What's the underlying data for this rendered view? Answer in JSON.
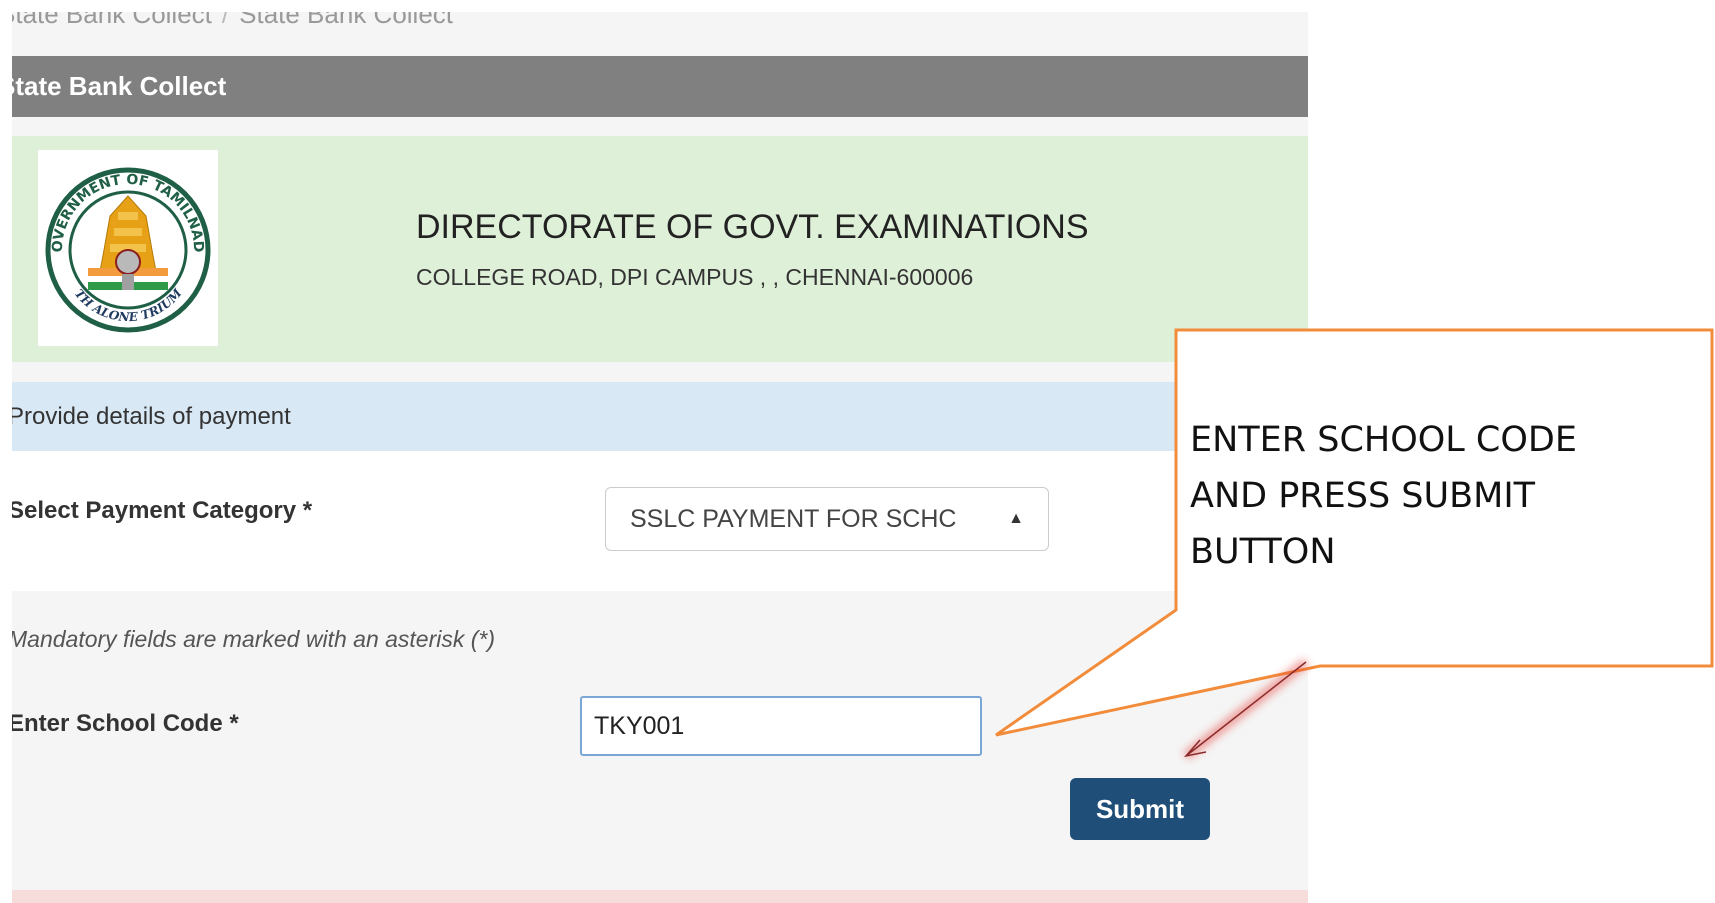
{
  "breadcrumb": [
    "State Bank Collect",
    "State Bank Collect"
  ],
  "breadcrumb_separator": "/",
  "header": {
    "title": "State Bank Collect"
  },
  "merchant": {
    "name": "DIRECTORATE OF GOVT. EXAMINATIONS",
    "address": "COLLEGE ROAD, DPI CAMPUS , , CHENNAI-600006",
    "emblem_text_top": "GOVERNMENT OF TAMILNADU",
    "emblem_text_bottom": "TRUTH ALONE TRIUMPHS"
  },
  "form": {
    "heading": "Provide details of payment",
    "category_label": "Select Payment Category *",
    "category_value": "SSLC PAYMENT FOR SCHC",
    "mandatory_note": "Mandatory fields are marked with an asterisk (*)",
    "school_code_label": "Enter School Code *",
    "school_code_value": "TKY001",
    "submit_label": "Submit"
  },
  "callout": {
    "lines": [
      "ENTER SCHOOL CODE",
      "AND PRESS SUBMIT",
      "BUTTON"
    ]
  },
  "colors": {
    "header_bg": "#808080",
    "merchant_bg": "#dff0d8",
    "panel_heading_bg": "#d9e8f5",
    "submit_bg": "#1f4e79",
    "callout_border": "#f28c3a"
  }
}
